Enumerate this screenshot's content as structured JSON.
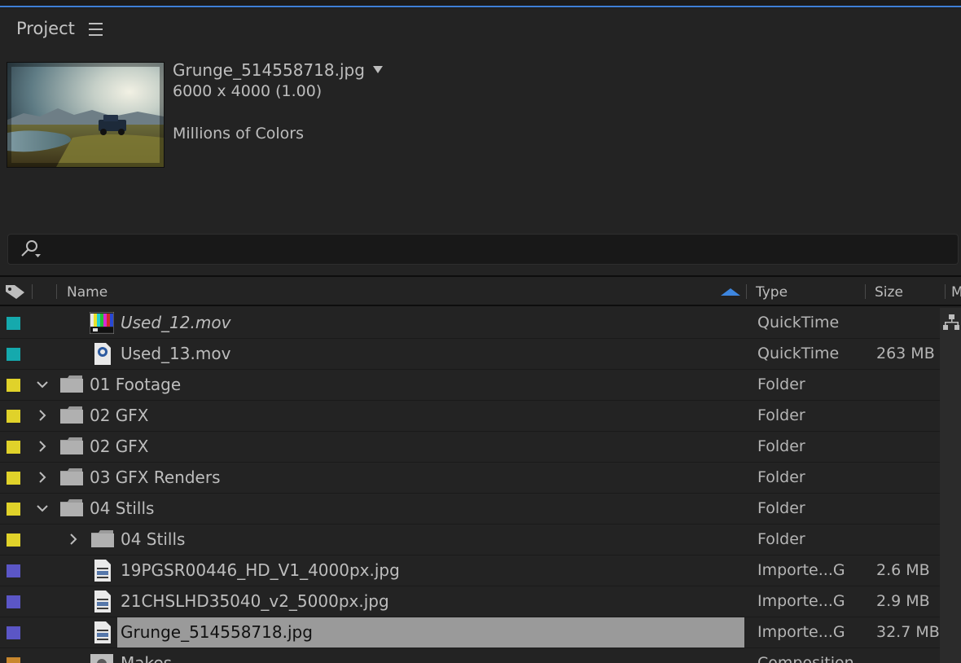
{
  "panel": {
    "title": "Project"
  },
  "preview": {
    "file_name": "Grunge_514558718.jpg",
    "dimensions": "6000 x 4000 (1.00)",
    "colors": "Millions of Colors"
  },
  "search": {
    "value": ""
  },
  "columns": {
    "name": "Name",
    "type": "Type",
    "size": "Size",
    "extra": "M"
  },
  "colors": {
    "teal": "#15a9ad",
    "yellow": "#e0d22a",
    "purple": "#5b56c6",
    "orange": "#c8872e",
    "accent_blue": "#3e7fd6"
  },
  "rows": [
    {
      "name": "Used_12.mov",
      "type": "QuickTime",
      "size": "",
      "label_color": "teal",
      "icon": "color-bars-icon",
      "italic": true,
      "twisty": ""
    },
    {
      "name": "Used_13.mov",
      "type": "QuickTime",
      "size": "263 MB",
      "label_color": "teal",
      "icon": "quicktime-file-icon",
      "italic": false,
      "twisty": ""
    },
    {
      "name": "01 Footage",
      "type": "Folder",
      "size": "",
      "label_color": "yellow",
      "icon": "folder-icon",
      "italic": false,
      "twisty": "open"
    },
    {
      "name": "02 GFX",
      "type": "Folder",
      "size": "",
      "label_color": "yellow",
      "icon": "folder-icon",
      "italic": false,
      "twisty": "closed"
    },
    {
      "name": "02 GFX",
      "type": "Folder",
      "size": "",
      "label_color": "yellow",
      "icon": "folder-icon",
      "italic": false,
      "twisty": "closed"
    },
    {
      "name": "03 GFX Renders",
      "type": "Folder",
      "size": "",
      "label_color": "yellow",
      "icon": "folder-icon",
      "italic": false,
      "twisty": "closed"
    },
    {
      "name": "04 Stills",
      "type": "Folder",
      "size": "",
      "label_color": "yellow",
      "icon": "folder-icon",
      "italic": false,
      "twisty": "open"
    },
    {
      "name": "04 Stills",
      "type": "Folder",
      "size": "",
      "label_color": "yellow",
      "icon": "folder-icon",
      "italic": false,
      "twisty": "closed"
    },
    {
      "name": "19PGSR00446_HD_V1_4000px.jpg",
      "type": "Importe...G",
      "size": "2.6 MB",
      "label_color": "purple",
      "icon": "image-file-icon",
      "italic": false,
      "twisty": ""
    },
    {
      "name": "21CHSLHD35040_v2_5000px.jpg",
      "type": "Importe...G",
      "size": "2.9 MB",
      "label_color": "purple",
      "icon": "image-file-icon",
      "italic": false,
      "twisty": ""
    },
    {
      "name": "Grunge_514558718.jpg",
      "type": "Importe...G",
      "size": "32.7 MB",
      "label_color": "purple",
      "icon": "image-file-icon",
      "italic": false,
      "twisty": "",
      "selected": true
    },
    {
      "name": "Makes",
      "type": "Composition",
      "size": "",
      "label_color": "orange",
      "icon": "composition-icon",
      "italic": false,
      "twisty": ""
    }
  ]
}
